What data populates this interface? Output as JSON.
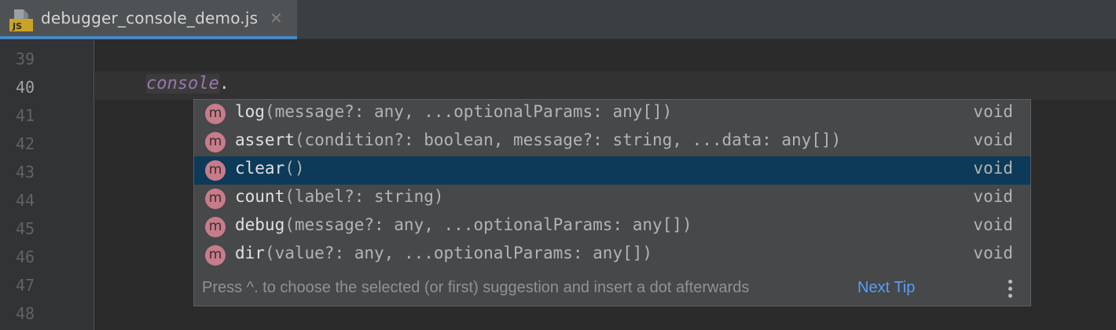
{
  "tab": {
    "title": "debugger_console_demo.js",
    "file_icon": "javascript-file-icon",
    "file_badge": "JS",
    "close_glyph": "✕"
  },
  "editor": {
    "line_numbers": [
      "39",
      "40",
      "41",
      "42",
      "43",
      "44",
      "45",
      "46",
      "47",
      "48"
    ],
    "current_line": "40",
    "code_object": "console",
    "code_dot": "."
  },
  "completion": {
    "items": [
      {
        "kind": "m",
        "name": "log",
        "params": "(message?: any, ...optionalParams: any[])",
        "type": "void"
      },
      {
        "kind": "m",
        "name": "assert",
        "params": "(condition?: boolean, message?: string, ...data: any[])",
        "type": "void"
      },
      {
        "kind": "m",
        "name": "clear",
        "params": "()",
        "type": "void"
      },
      {
        "kind": "m",
        "name": "count",
        "params": "(label?: string)",
        "type": "void"
      },
      {
        "kind": "m",
        "name": "debug",
        "params": "(message?: any, ...optionalParams: any[])",
        "type": "void"
      },
      {
        "kind": "m",
        "name": "dir",
        "params": "(value?: any, ...optionalParams: any[])",
        "type": "void"
      }
    ],
    "selected_index": 2,
    "hint": "Press ^. to choose the selected (or first) suggestion and insert a dot afterwards",
    "next_tip": "Next Tip",
    "more_icon": "vertical-ellipsis-icon"
  },
  "colors": {
    "accent": "#4a88c7",
    "selection": "#0d3a58",
    "method_icon": "#c77c8a",
    "link": "#589df6"
  }
}
